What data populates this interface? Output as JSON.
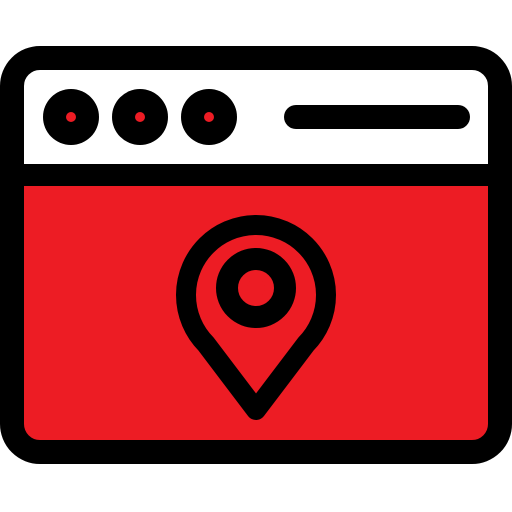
{
  "icon": {
    "name": "browser-window-location-icon",
    "colors": {
      "stroke": "#000000",
      "header_fill": "#ffffff",
      "body_fill": "#ed1c24",
      "dot_center": "#ed1c24"
    },
    "header_dots": [
      "window-dot",
      "window-dot",
      "window-dot"
    ],
    "address_bar": "address-bar",
    "content_pin": "map-pin"
  }
}
